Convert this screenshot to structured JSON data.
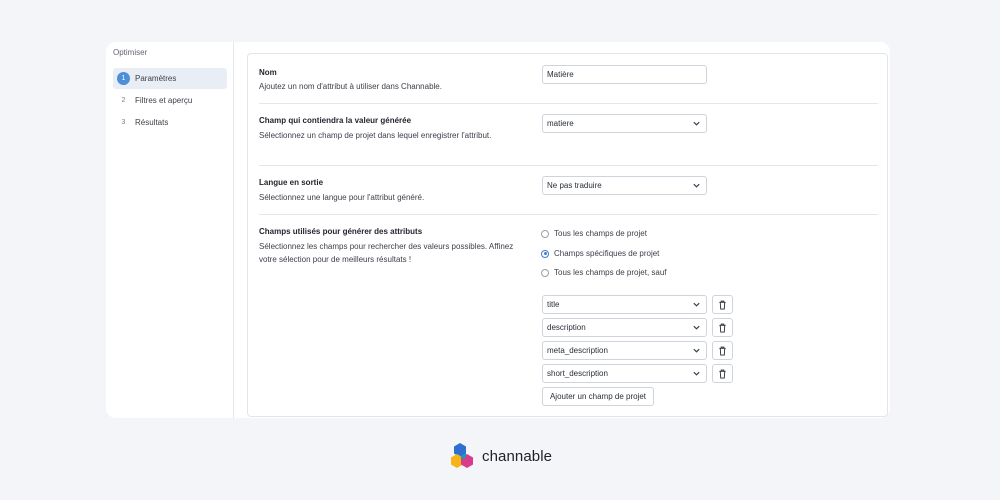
{
  "sidebar": {
    "title": "Optimiser",
    "steps": [
      {
        "num": "1",
        "label": "Paramètres"
      },
      {
        "num": "2",
        "label": "Filtres et aperçu"
      },
      {
        "num": "3",
        "label": "Résultats"
      }
    ]
  },
  "form": {
    "name": {
      "title": "Nom",
      "desc": "Ajoutez un nom d'attribut à utiliser dans Channable.",
      "value": "Matière"
    },
    "target_field": {
      "title": "Champ qui contiendra la valeur générée",
      "desc": "Sélectionnez un champ de projet dans lequel enregistrer l'attribut.",
      "value": "matiere"
    },
    "language": {
      "title": "Langue en sortie",
      "desc": "Sélectionnez une langue pour l'attribut généré.",
      "value": "Ne pas traduire"
    },
    "source_fields": {
      "title": "Champs utilisés pour générer des attributs",
      "desc": "Sélectionnez les champs pour rechercher des valeurs possibles. Affinez votre sélection pour de meilleurs résultats !",
      "options": [
        "Tous les champs de projet",
        "Champs spécifiques de projet",
        "Tous les champs de projet, sauf"
      ],
      "selected_option": "Champs spécifiques de projet",
      "fields": [
        "title",
        "description",
        "meta_description",
        "short_description"
      ],
      "add_label": "Ajouter un champ de projet"
    }
  },
  "brand": {
    "name": "channable"
  },
  "colors": {
    "accent": "#4a8fd8",
    "background": "#f4f5f9"
  }
}
